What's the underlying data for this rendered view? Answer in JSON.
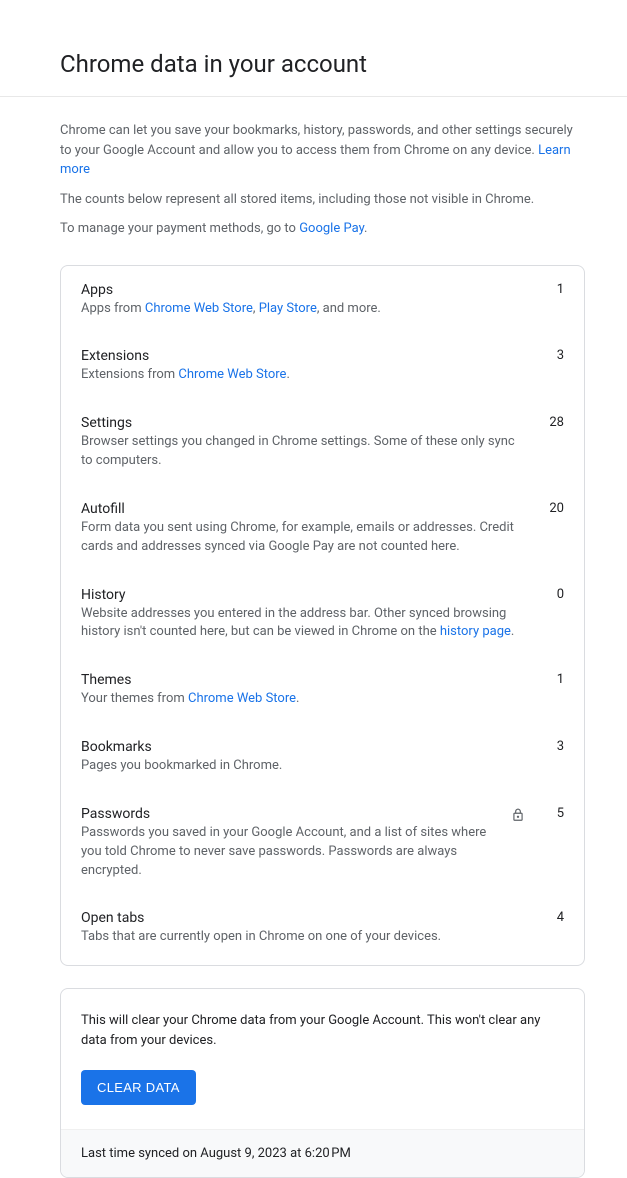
{
  "page_title": "Chrome data in your account",
  "intro": {
    "line1_a": "Chrome can let you save your bookmarks, history, passwords, and other settings securely to your Google Account and allow you to access them from Chrome on any device. ",
    "learn_more": "Learn more",
    "line2": "The counts below represent all stored items, including those not visible in Chrome.",
    "line3_a": "To manage your payment methods, go to ",
    "google_pay": "Google Pay",
    "line3_b": "."
  },
  "rows": {
    "apps": {
      "title": "Apps",
      "d1": "Apps from ",
      "link1": "Chrome Web Store",
      "sep": ", ",
      "link2": "Play Store",
      "d2": ", and more.",
      "count": "1"
    },
    "extensions": {
      "title": "Extensions",
      "d1": "Extensions from ",
      "link1": "Chrome Web Store",
      "d2": ".",
      "count": "3"
    },
    "settings": {
      "title": "Settings",
      "d1": "Browser settings you changed in Chrome settings. Some of these only sync to computers.",
      "count": "28"
    },
    "autofill": {
      "title": "Autofill",
      "d1": "Form data you sent using Chrome, for example, emails or addresses. Credit cards and addresses synced via Google Pay are not counted here.",
      "count": "20"
    },
    "history": {
      "title": "History",
      "d1": "Website addresses you entered in the address bar. Other synced browsing history isn't counted here, but can be viewed in Chrome on the ",
      "link1": "history page",
      "d2": ".",
      "count": "0"
    },
    "themes": {
      "title": "Themes",
      "d1": "Your themes from ",
      "link1": "Chrome Web Store",
      "d2": ".",
      "count": "1"
    },
    "bookmarks": {
      "title": "Bookmarks",
      "d1": "Pages you bookmarked in Chrome.",
      "count": "3"
    },
    "passwords": {
      "title": "Passwords",
      "d1": "Passwords you saved in your Google Account, and a list of sites where you told Chrome to never save passwords. Passwords are always encrypted.",
      "count": "5"
    },
    "opentabs": {
      "title": "Open tabs",
      "d1": "Tabs that are currently open in Chrome on one of your devices.",
      "count": "4"
    }
  },
  "clear": {
    "text": "This will clear your Chrome data from your Google Account. This won't clear any data from your devices.",
    "button": "Clear Data"
  },
  "sync_footer": "Last time synced on August 9, 2023 at 6:20 PM"
}
